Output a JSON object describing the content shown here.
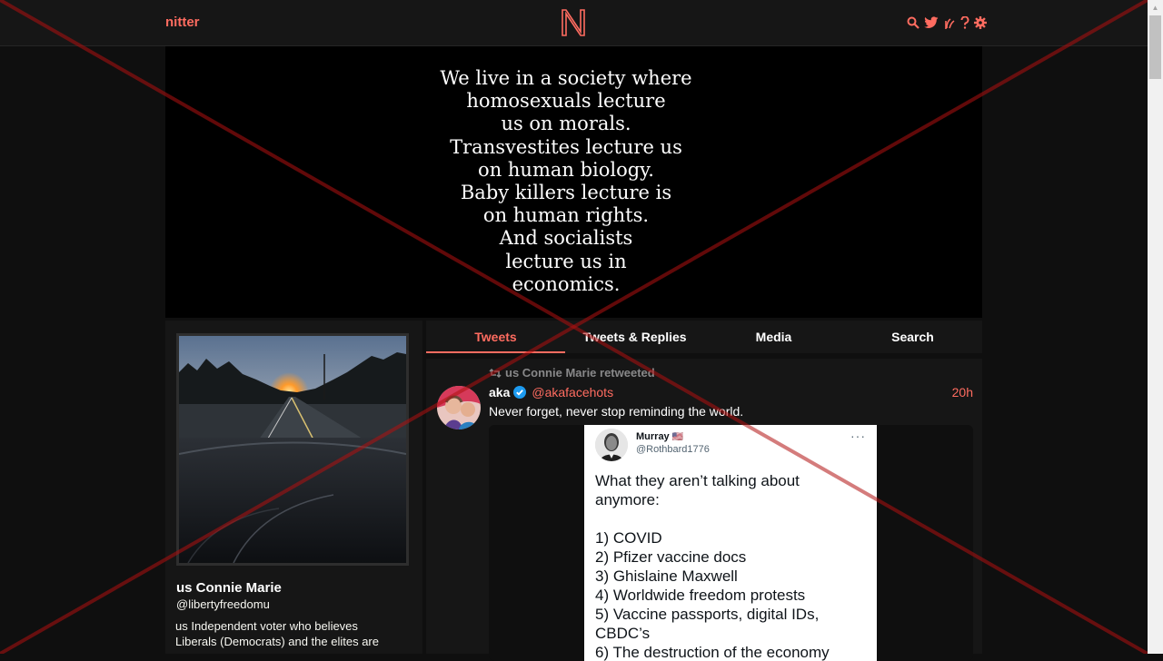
{
  "nav": {
    "brand": "nitter",
    "icons": [
      "search-icon",
      "twitter-bird-icon",
      "rss-icon",
      "help-icon",
      "settings-icon"
    ]
  },
  "banner": {
    "lines": [
      "We live in a society where",
      "homosexuals lecture",
      "us on morals.",
      "Transvestites lecture us",
      "on human biology.",
      "Baby killers lecture is",
      "on human rights.",
      "And socialists",
      "lecture us in",
      "economics."
    ]
  },
  "profile": {
    "fullname": "us Connie Marie",
    "username": "@libertyfreedomu",
    "bio_line1": "us Independent voter who believes",
    "bio_line2": "Liberals (Democrats) and the elites are"
  },
  "tabs": [
    {
      "label": "Tweets",
      "active": true
    },
    {
      "label": "Tweets & Replies",
      "active": false
    },
    {
      "label": "Media",
      "active": false
    },
    {
      "label": "Search",
      "active": false
    }
  ],
  "tweet": {
    "retweet_label": "us Connie Marie retweeted",
    "fullname": "aka",
    "username": "@akafacehots",
    "date": "20h",
    "text": "Never forget, never stop reminding the world.",
    "embedded": {
      "name": "Murray",
      "flag": "🇺🇸",
      "handle": "@Rothbard1776",
      "more": "···",
      "lines": [
        "What they aren’t talking about",
        "anymore:",
        "",
        "1) COVID",
        "2) Pfizer vaccine docs",
        "3) Ghislaine Maxwell",
        "4) Worldwide freedom protests",
        "5) Vaccine passports, digital IDs,",
        "CBDC’s",
        "6) The destruction of the economy"
      ]
    }
  },
  "colors": {
    "accent": "#ff6c60",
    "background": "#0f0f0f",
    "panel": "#161616",
    "overlay_x": "#b01010"
  }
}
